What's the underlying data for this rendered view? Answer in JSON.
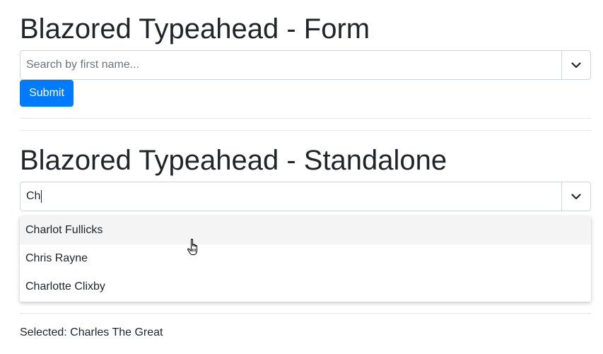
{
  "form_section": {
    "heading": "Blazored Typeahead - Form",
    "search": {
      "placeholder": "Search by first name...",
      "value": ""
    },
    "toggle_icon": "chevron-down-icon",
    "submit_label": "Submit"
  },
  "standalone_section": {
    "heading": "Blazored Typeahead - Standalone",
    "search": {
      "value": "Ch"
    },
    "toggle_icon": "chevron-down-icon",
    "results": [
      {
        "label": "Charlot Fullicks",
        "highlighted": true
      },
      {
        "label": "Chris Rayne",
        "highlighted": false
      },
      {
        "label": "Charlotte Clixby",
        "highlighted": false
      }
    ],
    "selected_prefix": "Selected:",
    "selected_value": "Charles The Great"
  },
  "colors": {
    "primary": "#007bff",
    "text": "#212529",
    "border": "#ced4da",
    "placeholder": "#6c757d",
    "highlight": "#f4f4f4"
  },
  "cursor_icon": "hand-pointer-icon"
}
